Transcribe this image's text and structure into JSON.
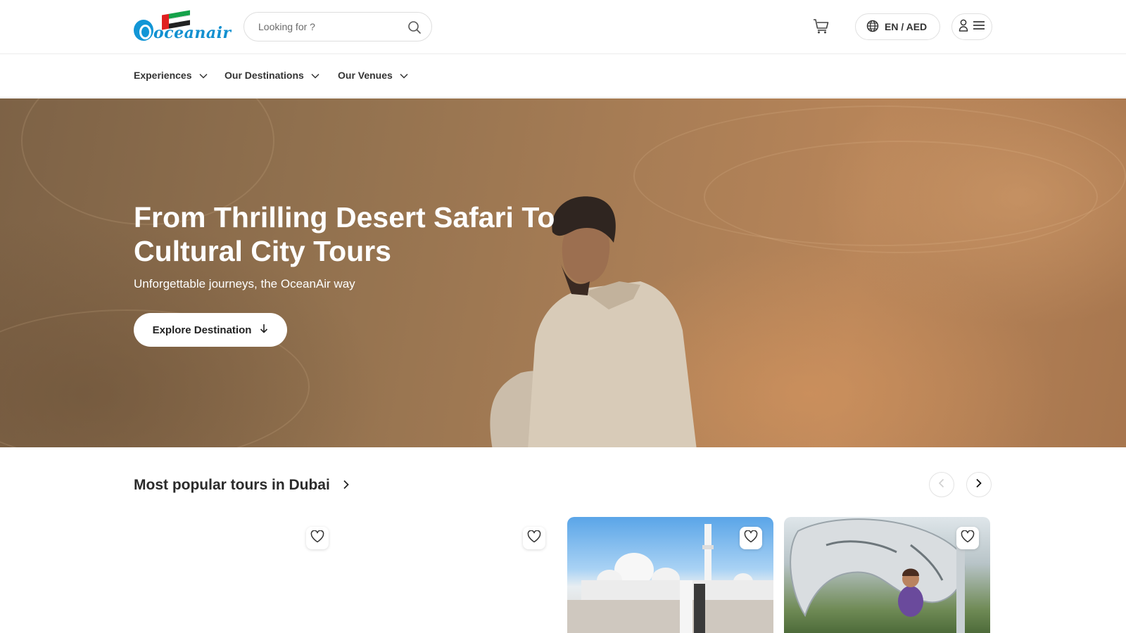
{
  "header": {
    "logo_text": "oceanair",
    "search": {
      "placeholder": "Looking for ?"
    },
    "language_currency": "EN / AED"
  },
  "nav": {
    "items": [
      {
        "label": "Experiences"
      },
      {
        "label": "Our Destinations"
      },
      {
        "label": "Our Venues"
      }
    ]
  },
  "hero": {
    "title": "From Thrilling Desert Safari To Cultural City Tours",
    "subtitle": "Unforgettable journeys, the OceanAir way",
    "cta_label": "Explore Destination"
  },
  "popular": {
    "title": "Most popular tours in Dubai"
  },
  "icons": {
    "search": "search-icon",
    "cart": "cart-icon",
    "globe": "globe-icon",
    "user": "user-icon",
    "menu": "menu-icon",
    "chevron": "chevron-down-icon",
    "arrow_down": "arrow-down-icon",
    "heart": "heart-icon"
  },
  "colors": {
    "brand_blue": "#1296d6",
    "flag_red": "#e02020",
    "flag_green": "#15a24a",
    "text_dark": "#2b2b2b"
  }
}
